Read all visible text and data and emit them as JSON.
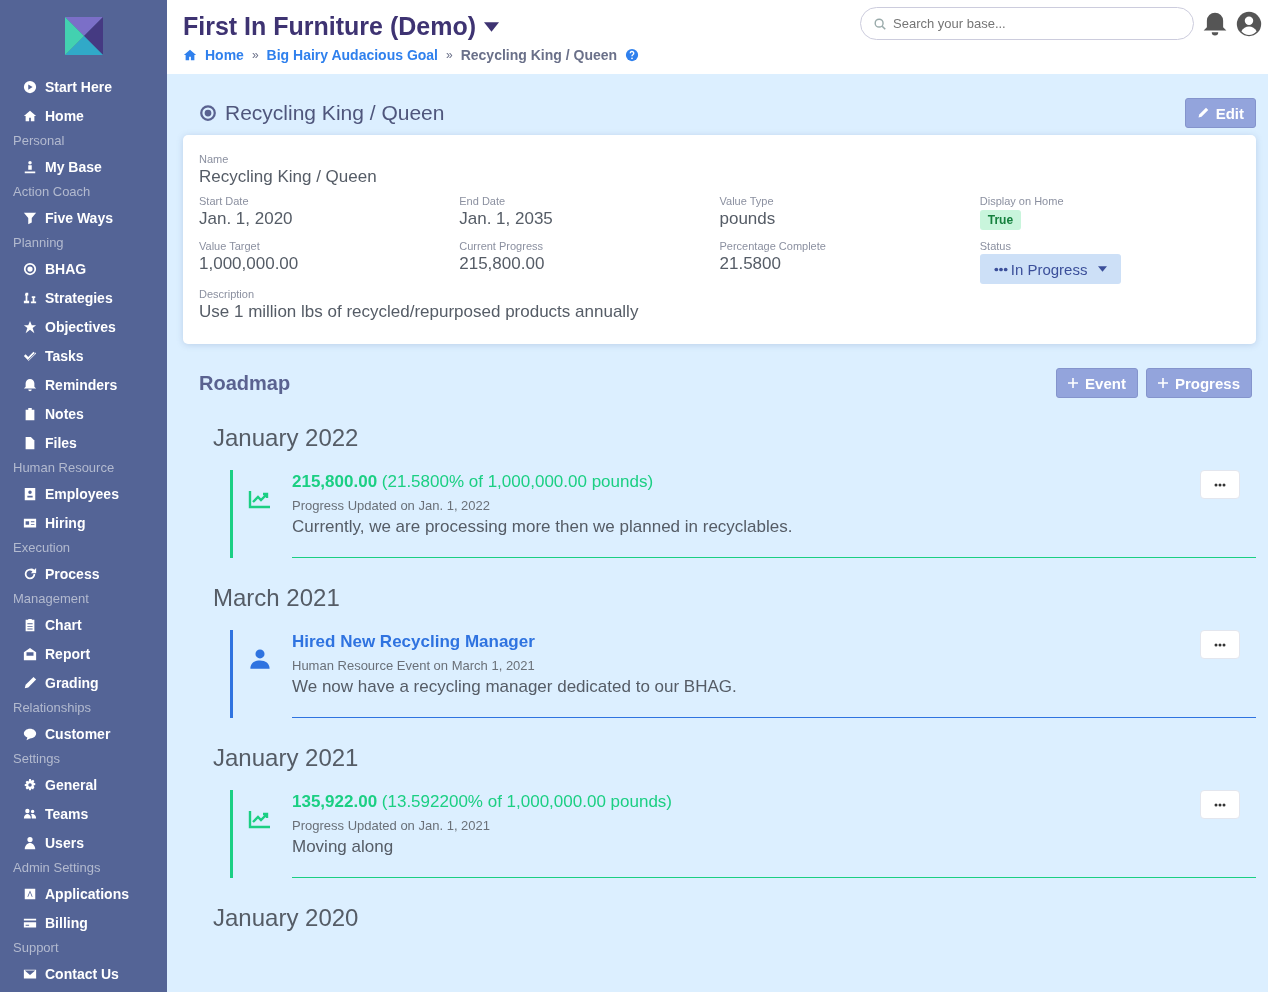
{
  "sidebar": {
    "groups": [
      {
        "items": [
          {
            "label": "Start Here"
          },
          {
            "label": "Home"
          }
        ]
      },
      {
        "heading": "Personal",
        "items": [
          {
            "label": "My Base"
          }
        ]
      },
      {
        "heading": "Action Coach",
        "items": [
          {
            "label": "Five Ways"
          }
        ]
      },
      {
        "heading": "Planning",
        "items": [
          {
            "label": "BHAG"
          },
          {
            "label": "Strategies"
          },
          {
            "label": "Objectives"
          },
          {
            "label": "Tasks"
          },
          {
            "label": "Reminders"
          },
          {
            "label": "Notes"
          },
          {
            "label": "Files"
          }
        ]
      },
      {
        "heading": "Human Resource",
        "items": [
          {
            "label": "Employees"
          },
          {
            "label": "Hiring"
          }
        ]
      },
      {
        "heading": "Execution",
        "items": [
          {
            "label": "Process"
          }
        ]
      },
      {
        "heading": "Management",
        "items": [
          {
            "label": "Chart"
          },
          {
            "label": "Report"
          },
          {
            "label": "Grading"
          }
        ]
      },
      {
        "heading": "Relationships",
        "items": [
          {
            "label": "Customer"
          }
        ]
      },
      {
        "heading": "Settings",
        "items": [
          {
            "label": "General"
          },
          {
            "label": "Teams"
          },
          {
            "label": "Users"
          }
        ]
      },
      {
        "heading": "Admin Settings",
        "items": [
          {
            "label": "Applications"
          },
          {
            "label": "Billing"
          }
        ]
      },
      {
        "heading": "Support",
        "items": [
          {
            "label": "Contact Us"
          }
        ]
      }
    ]
  },
  "header": {
    "company": "First In Furniture (Demo)",
    "breadcrumbs": [
      "Home",
      "Big Hairy Audacious Goal",
      "Recycling King / Queen"
    ],
    "breadcrumb_separator": "»",
    "search": {
      "placeholder": "Search your base..."
    }
  },
  "goal": {
    "title": "Recycling King / Queen",
    "edit_button": "Edit",
    "name": {
      "label": "Name",
      "value": "Recycling King / Queen"
    },
    "fields": [
      {
        "label": "Start Date",
        "value": "Jan. 1, 2020"
      },
      {
        "label": "End Date",
        "value": "Jan. 1, 2035"
      },
      {
        "label": "Value Type",
        "value": "pounds"
      },
      {
        "label": "Display on Home",
        "value": "True",
        "kind": "badge"
      },
      {
        "label": "Value Target",
        "value": "1,000,000.00"
      },
      {
        "label": "Current Progress",
        "value": "215,800.00"
      },
      {
        "label": "Percentage Complete",
        "value": "21.5800"
      },
      {
        "label": "Status",
        "value": "In Progress",
        "kind": "dropdown"
      }
    ],
    "description": {
      "label": "Description",
      "value": "Use 1 million lbs of recycled/repurposed products annually"
    }
  },
  "roadmap": {
    "title": "Roadmap",
    "buttons": [
      "Event",
      "Progress"
    ],
    "sections": [
      {
        "heading": "January 2022",
        "entries": [
          {
            "kind": "progress",
            "title": "**215,800.00** (21.5800% of 1,000,000.00 pounds)",
            "meta": "Progress Updated on Jan. 1, 2022",
            "text": "Currently, we are processing more then we planned in recyclables."
          }
        ]
      },
      {
        "heading": "March 2021",
        "entries": [
          {
            "kind": "event",
            "title": "Hired New Recycling Manager",
            "meta": "Human Resource Event on March 1, 2021",
            "text": "We now have a recycling manager dedicated to our BHAG."
          }
        ]
      },
      {
        "heading": "January 2021",
        "entries": [
          {
            "kind": "progress",
            "title": "**135,922.00** (13.592200% of 1,000,000.00 pounds)",
            "meta": "Progress Updated on Jan. 1, 2021",
            "text": "Moving along"
          }
        ]
      },
      {
        "heading": "January 2020"
      }
    ]
  }
}
